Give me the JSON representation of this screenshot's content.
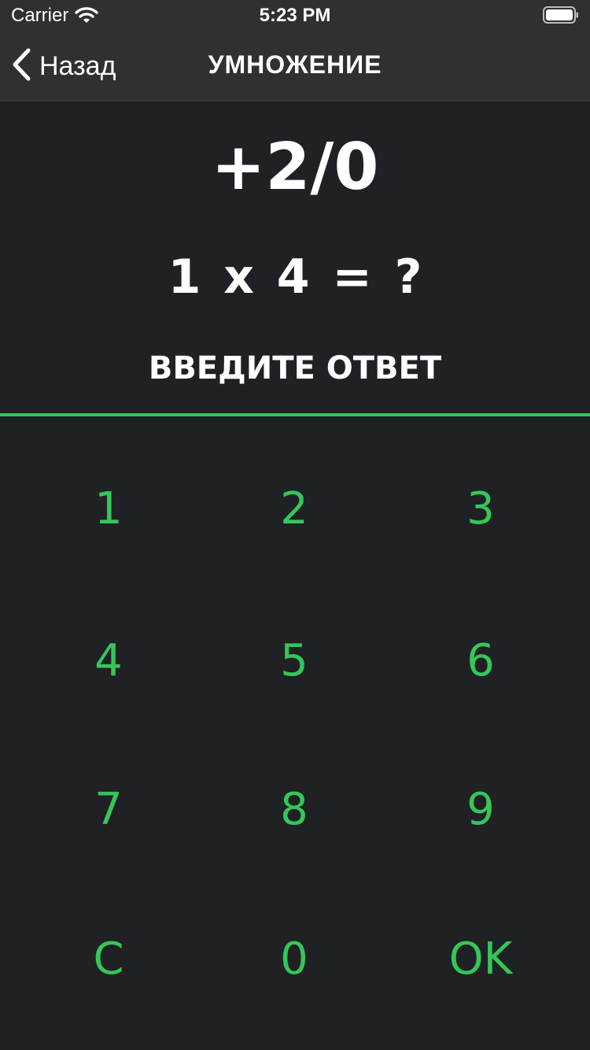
{
  "status_bar": {
    "carrier": "Carrier",
    "time": "5:23 PM"
  },
  "nav": {
    "back_label": "Назад",
    "title": "УМНОЖЕНИЕ"
  },
  "game": {
    "score": "+2/0",
    "question": "1 x 4 = ?",
    "answer_placeholder": "ВВЕДИТЕ ОТВЕТ"
  },
  "keypad": {
    "keys": [
      "1",
      "2",
      "3",
      "4",
      "5",
      "6",
      "7",
      "8",
      "9",
      "C",
      "0",
      "OK"
    ]
  },
  "colors": {
    "background": "#202124",
    "bar": "#2f3032",
    "accent": "#34c759",
    "text": "#ffffff"
  },
  "icons": {
    "wifi": "wifi-icon",
    "battery": "battery-icon",
    "back": "chevron-left-icon"
  }
}
